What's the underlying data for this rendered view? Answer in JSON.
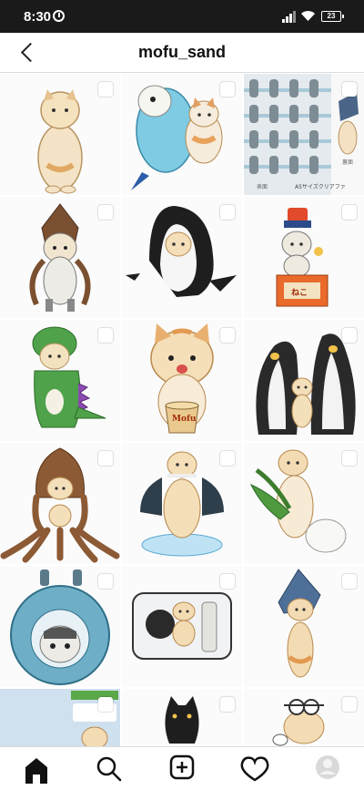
{
  "status_bar": {
    "time": "8:30",
    "battery": "23"
  },
  "header": {
    "title": "mofu_sand"
  },
  "posts": [
    {
      "subject": "cat-standing"
    },
    {
      "subject": "blue-parakeet-with-cat"
    },
    {
      "subject": "clear-file-product",
      "caption_1": "表面",
      "caption_2": "A5サイズクリアファ",
      "caption_3": "裏面"
    },
    {
      "subject": "cat-in-squid-costume"
    },
    {
      "subject": "cat-in-orca-costume"
    },
    {
      "subject": "cat-on-stand",
      "label": "ねこ"
    },
    {
      "subject": "cat-in-dinosaur-costume"
    },
    {
      "subject": "cat-with-noodles",
      "label": "Mofu"
    },
    {
      "subject": "cat-with-penguins"
    },
    {
      "subject": "cat-in-octopus-costume"
    },
    {
      "subject": "cat-with-cape"
    },
    {
      "subject": "cat-holding-daikon"
    },
    {
      "subject": "cat-in-shark-hood"
    },
    {
      "subject": "pouch-with-cat"
    },
    {
      "subject": "cat-with-shark-hat"
    },
    {
      "subject": "screenshot-chat"
    },
    {
      "subject": "black-cat"
    },
    {
      "subject": "cat-with-goggles"
    }
  ],
  "bottom_nav": [
    "home",
    "search",
    "add",
    "activity",
    "profile"
  ]
}
